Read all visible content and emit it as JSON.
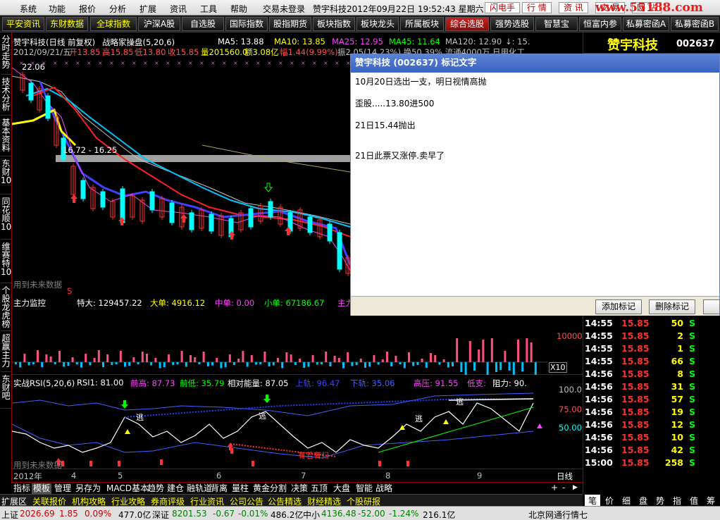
{
  "menu": {
    "items": [
      "系统",
      "功能",
      "报价",
      "分析",
      "扩展",
      "资讯",
      "工具",
      "帮助",
      "交易未登录"
    ],
    "title": "赞宇科技2012年09月22日 19:52:43 星期六",
    "right_buttons": [
      "闪电手",
      "行 情",
      "资 讯",
      "交 易",
      "网 站"
    ],
    "site": "www.55188.com"
  },
  "toolbar": {
    "items": [
      "平安资讯",
      "东财数据",
      "全球指数",
      "沪深A股",
      "自选股",
      "国际指数",
      "股指期货",
      "板块指数",
      "板块龙头",
      "所属板块",
      "综合选股",
      "强势选股",
      "智慧宝",
      "恒富内参",
      "私募密函A",
      "私募密函B"
    ]
  },
  "left_tabs": [
    "分时走势",
    "技术分析",
    "基本资料",
    "东财10",
    "同花顺10",
    "维赛特10",
    "个股龙虎榜",
    "超赢主力",
    "东财吧"
  ],
  "main_chart": {
    "stock_title": "赞宇科技(日线 前复权)",
    "indicator": "战略家操盘(5,20,6)",
    "ma5": "MA5: 13.88",
    "ma10": "MA10: 13.85",
    "ma25": "MA25: 12.95",
    "ma45": "MA45: 11.64",
    "ma120": "MA120: 12.90",
    "ma_tail": "↓: 15.",
    "quote_date": "2012/09/21/五",
    "open": "开13.85",
    "high": "高15.85",
    "low": "低13.80",
    "close": "收15.85",
    "vol": "量201560.0",
    "amt": "额3.08亿",
    "amp": "幅1.44(9.99%)",
    "quote_tail": "振2.05(14.23%) 换50.39% 流通4000万 日用化工",
    "price_high": "22.06",
    "range_label": "16.72 - 16.25",
    "future_label": "用到未来数据",
    "s_mark": "S"
  },
  "main_force": {
    "title": "主力监控",
    "special": "特大: 129457.22",
    "big": "大单: 4916.12",
    "mid": "中单: 0.00",
    "small": "小单: 67186.67",
    "tail": "主力",
    "axis": [
      "10000",
      "X10"
    ]
  },
  "rsi": {
    "title": "实战RSI(5,20,6)",
    "rsi1": "RSI1: 81.00",
    "prev_high": "前高: 87.73",
    "prev_low": "前低: 35.79",
    "rel": "相对能量: 87.05",
    "up": "上轨: 96.47",
    "down": "下轨: 35.06",
    "high": "高压: 91.55",
    "low": "低支:",
    "resist": "阻力: 90.",
    "axis": [
      "100.0",
      "75.00",
      "50.00"
    ],
    "future_label": "用到未来数据",
    "sell_label": "逃",
    "note": "有若有归"
  },
  "xaxis": {
    "labels": [
      "2012年",
      "4",
      "5",
      "6",
      "7",
      "8",
      "9"
    ],
    "period": "日线"
  },
  "right_panel": {
    "name": "赞宇科技",
    "code": "002637",
    "rows": [
      {
        "time": "14:55",
        "price": "15.85",
        "vol": "50",
        "side": "S"
      },
      {
        "time": "14:55",
        "price": "15.85",
        "vol": "2",
        "side": "S"
      },
      {
        "time": "14:55",
        "price": "15.85",
        "vol": "1",
        "side": "S"
      },
      {
        "time": "14:55",
        "price": "15.85",
        "vol": "66",
        "side": "S"
      },
      {
        "time": "14:56",
        "price": "15.85",
        "vol": "8",
        "side": "S"
      },
      {
        "time": "14:56",
        "price": "15.85",
        "vol": "31",
        "side": "S"
      },
      {
        "time": "14:56",
        "price": "15.85",
        "vol": "57",
        "side": "S"
      },
      {
        "time": "14:56",
        "price": "15.85",
        "vol": "19",
        "side": "S"
      },
      {
        "time": "14:56",
        "price": "15.85",
        "vol": "12",
        "side": "S"
      },
      {
        "time": "14:56",
        "price": "15.85",
        "vol": "10",
        "side": "S"
      },
      {
        "time": "14:56",
        "price": "15.85",
        "vol": "42",
        "side": "S"
      },
      {
        "time": "15:00",
        "price": "15.85",
        "vol": "258",
        "side": "S"
      }
    ]
  },
  "dialog": {
    "title": "赞宇科技 (002637) 标记文字",
    "lines": [
      "10月20日选出一支，明日视情高抛",
      "歪股.....13.80进500",
      "21日15.44抛出",
      "21日此票又涨停.卖早了"
    ],
    "add": "添加标记",
    "del": "删除标记"
  },
  "bottom_tabs": [
    "指标",
    "模板",
    "管理",
    "另存为",
    "MACD基本",
    "趋势",
    "建仓",
    "融轨道",
    "背离",
    "量柱",
    "黄金分割",
    "决策",
    "五顶",
    "大盘",
    "智能",
    "战略"
  ],
  "bottom_tabs2": [
    "扩展区",
    "关联报价",
    "机构攻略",
    "行业攻略",
    "券商评级",
    "行业资讯",
    "公司公告",
    "公告精选",
    "财经精选",
    "个股研报"
  ],
  "right_bottom_tabs": [
    "笔",
    "价",
    "细",
    "盘",
    "势",
    "指",
    "值",
    "筹"
  ],
  "status": {
    "sh_label": "上证",
    "sh": "2026.69",
    "sh_chg": "1.85",
    "sh_pct": "0.09%",
    "sh_amt": "477.0亿",
    "sz_label": "深证",
    "sz": "8201.53",
    "sz_chg": "-0.67",
    "sz_pct": "-0.01%",
    "sz_amt": "486.2亿",
    "zx_label": "中小",
    "zx": "4136.48",
    "zx_chg": "-52.00",
    "zx_pct": "-1.24%",
    "zx_amt": "216.1亿",
    "net": "北京网通行情七"
  },
  "colors": {
    "up": "#ff3030",
    "down": "#00ffff",
    "yellow": "#ffff00",
    "green": "#00ff00",
    "magenta": "#ff00ff"
  }
}
